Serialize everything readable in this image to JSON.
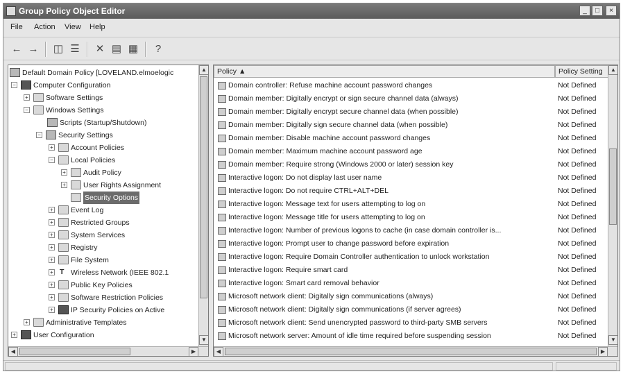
{
  "window": {
    "title": "Group Policy Object Editor"
  },
  "menu": [
    "File",
    "Action",
    "View",
    "Help"
  ],
  "toolbar": [
    "back-icon",
    "forward-icon",
    "up-folder-icon",
    "show-hide-tree-icon",
    "delete-icon",
    "properties-icon",
    "export-list-icon",
    "help-icon"
  ],
  "tree": {
    "items": [
      {
        "label": "Default Domain Policy [LOVELAND.elmoelogic"
      },
      {
        "label": "Computer Configuration"
      },
      {
        "label": "Software Settings"
      },
      {
        "label": "Windows Settings"
      },
      {
        "label": "Scripts (Startup/Shutdown)"
      },
      {
        "label": "Security Settings"
      },
      {
        "label": "Account Policies"
      },
      {
        "label": "Local Policies"
      },
      {
        "label": "Audit Policy"
      },
      {
        "label": "User Rights Assignment"
      },
      {
        "label": "Security Options"
      },
      {
        "label": "Event Log"
      },
      {
        "label": "Restricted Groups"
      },
      {
        "label": "System Services"
      },
      {
        "label": "Registry"
      },
      {
        "label": "File System"
      },
      {
        "label": "Wireless Network (IEEE 802.1"
      },
      {
        "label": "Public Key Policies"
      },
      {
        "label": "Software Restriction Policies"
      },
      {
        "label": "IP Security Policies on Active"
      },
      {
        "label": "Administrative Templates"
      },
      {
        "label": "User Configuration"
      }
    ]
  },
  "list": {
    "columns": {
      "policy": "Policy",
      "setting": "Policy Setting"
    },
    "rows": [
      {
        "policy": "Domain controller: Refuse machine account password changes",
        "setting": "Not Defined"
      },
      {
        "policy": "Domain member: Digitally encrypt or sign secure channel data (always)",
        "setting": "Not Defined"
      },
      {
        "policy": "Domain member: Digitally encrypt secure channel data (when possible)",
        "setting": "Not Defined"
      },
      {
        "policy": "Domain member: Digitally sign secure channel data (when possible)",
        "setting": "Not Defined"
      },
      {
        "policy": "Domain member: Disable machine account password changes",
        "setting": "Not Defined"
      },
      {
        "policy": "Domain member: Maximum machine account password age",
        "setting": "Not Defined"
      },
      {
        "policy": "Domain member: Require strong (Windows 2000 or later) session key",
        "setting": "Not Defined"
      },
      {
        "policy": "Interactive logon: Do not display last user name",
        "setting": "Not Defined"
      },
      {
        "policy": "Interactive logon: Do not require CTRL+ALT+DEL",
        "setting": "Not Defined"
      },
      {
        "policy": "Interactive logon: Message text for users attempting to log on",
        "setting": "Not Defined"
      },
      {
        "policy": "Interactive logon: Message title for users attempting to log on",
        "setting": "Not Defined"
      },
      {
        "policy": "Interactive logon: Number of previous logons to cache (in case domain controller is...",
        "setting": "Not Defined"
      },
      {
        "policy": "Interactive logon: Prompt user to change password before expiration",
        "setting": "Not Defined"
      },
      {
        "policy": "Interactive logon: Require Domain Controller authentication to unlock workstation",
        "setting": "Not Defined"
      },
      {
        "policy": "Interactive logon: Require smart card",
        "setting": "Not Defined"
      },
      {
        "policy": "Interactive logon: Smart card removal behavior",
        "setting": "Not Defined"
      },
      {
        "policy": "Microsoft network client: Digitally sign communications (always)",
        "setting": "Not Defined"
      },
      {
        "policy": "Microsoft network client: Digitally sign communications (if server agrees)",
        "setting": "Not Defined"
      },
      {
        "policy": "Microsoft network client: Send unencrypted password to third-party SMB servers",
        "setting": "Not Defined"
      },
      {
        "policy": "Microsoft network server: Amount of idle time required before suspending session",
        "setting": "Not Defined"
      }
    ]
  }
}
